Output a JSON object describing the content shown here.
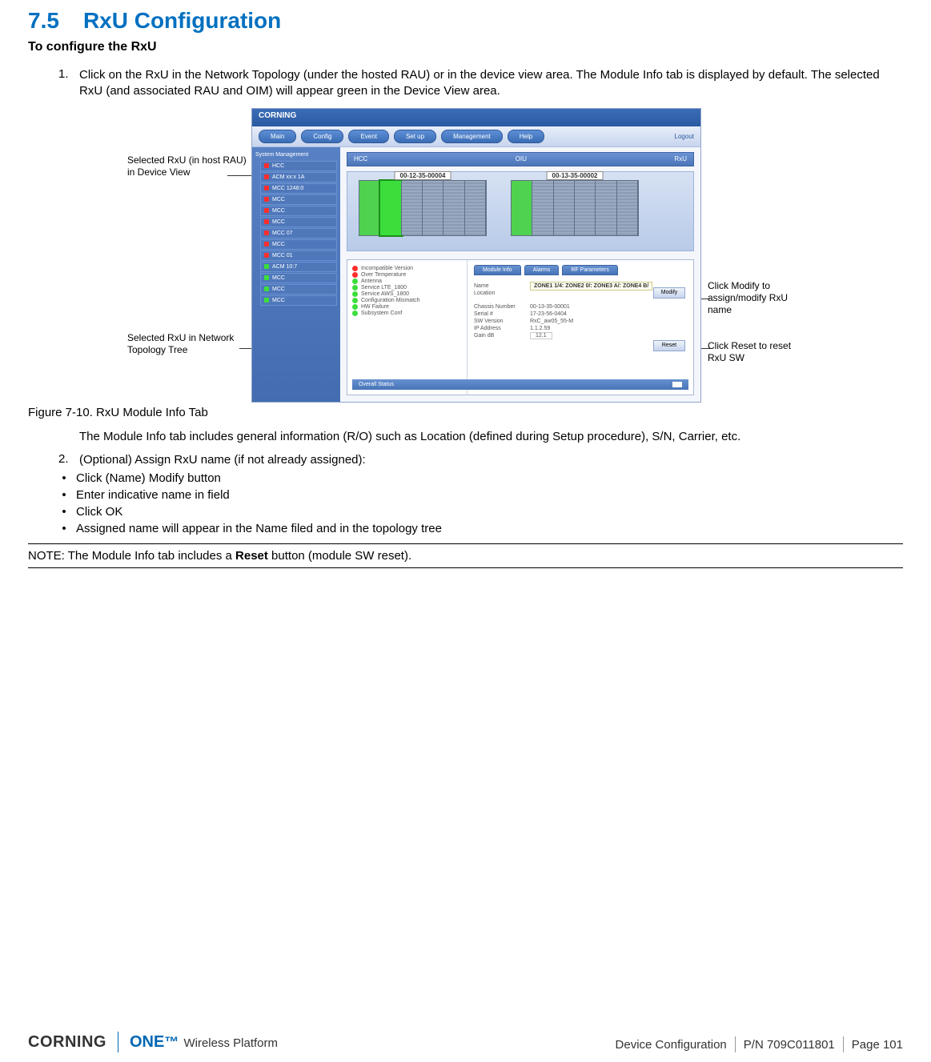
{
  "heading": {
    "number": "7.5",
    "title": "RxU Configuration"
  },
  "subheading": "To configure the RxU",
  "step1": {
    "num": "1.",
    "text": "Click on the RxU in the Network Topology (under the hosted RAU) or in the device view area. The Module Info tab is displayed by default. The selected RxU (and associated RAU and OIM) will appear green in the Device View area."
  },
  "figure": {
    "callouts": {
      "top_left": "Selected RxU (in host RAU) in Device View",
      "bottom_left": "Selected RxU in Network Topology Tree",
      "top_right": "Click Modify to assign/modify RxU name",
      "bottom_right": "Click Reset to reset RxU SW"
    },
    "window_title": "CORNING",
    "main_tabs": [
      "Main",
      "Config",
      "Event",
      "Set up",
      "Management",
      "Help"
    ],
    "logout": "Logout",
    "tree_header": "System Management",
    "tree_root": "HCC",
    "tree_items": [
      "ACM xx:x 1A",
      "MCC 1248:0",
      "MCC",
      "MCC",
      "MCC",
      "MCC 07",
      "MCC",
      "MCC 01",
      "ACM 10:7",
      "MCC",
      "MCC",
      "MCC"
    ],
    "device_bar": {
      "left": "HCC",
      "center": "OIU",
      "right": "RxU"
    },
    "chassis_labels": [
      "00-12-35-00004",
      "00-13-35-00002"
    ],
    "alarms": [
      {
        "led": "r",
        "text": "Incompatible Version"
      },
      {
        "led": "r",
        "text": "Over Temperature"
      },
      {
        "led": "g",
        "text": "Antenna"
      },
      {
        "led": "g",
        "text": "Service LTE_1800"
      },
      {
        "led": "g",
        "text": "Service AWS_1800"
      },
      {
        "led": "g",
        "text": "Configuration Mismatch"
      },
      {
        "led": "g",
        "text": "HW Failure"
      },
      {
        "led": "g",
        "text": "Subsystem Conf"
      }
    ],
    "info_tabs": [
      "Module Info",
      "Alarms",
      "RF Parameters"
    ],
    "info_rows": [
      {
        "k": "Name",
        "v_zone": "ZONE1 1/4: ZONE2 0/: ZONE3 A/: ZONE4 B/"
      },
      {
        "k": "Location",
        "v": ""
      },
      {
        "k": "Chassis Number",
        "v": "00-13-35-00001"
      },
      {
        "k": "Serial #",
        "v": "17-23-56-0404"
      },
      {
        "k": "SW Version",
        "v": "RxC_aw05_55-M"
      },
      {
        "k": "IP Address",
        "v": "1.1.2.59"
      },
      {
        "k": "Gain dB",
        "v": "12.1"
      }
    ],
    "buttons": {
      "modify": "Modify",
      "reset": "Reset"
    },
    "overall": {
      "label": "Overall Status",
      "value": ""
    }
  },
  "figure_caption": "Figure 7-10. RxU Module Info Tab",
  "para_after_figure": "The Module Info tab includes general information (R/O) such as Location (defined during Setup procedure), S/N, Carrier, etc.",
  "step2": {
    "num": "2.",
    "text": "(Optional) Assign RxU name (if not already assigned):"
  },
  "bullets": [
    "Click (Name) Modify button",
    "Enter indicative name in field",
    "Click OK",
    "Assigned name will appear in the Name filed and in the topology tree"
  ],
  "note": {
    "prefix": "NOTE: The Module Info tab includes a ",
    "bold": "Reset",
    "suffix": " button (module SW reset)."
  },
  "footer": {
    "brand1": "CORNING",
    "brand2_one": "ONE",
    "brand2_tm": "™",
    "brand2_rest": " Wireless Platform",
    "meta1": "Device Configuration",
    "meta2": "P/N 709C011801",
    "meta3": "Page 101"
  }
}
